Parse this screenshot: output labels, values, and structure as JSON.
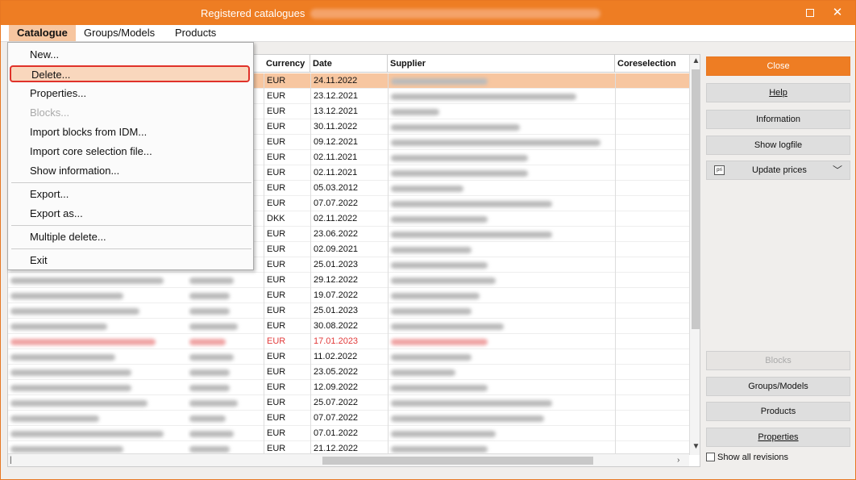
{
  "window": {
    "title": "Registered catalogues"
  },
  "menubar": {
    "catalogue": "Catalogue",
    "groups_models": "Groups/Models",
    "products": "Products"
  },
  "dropdown": {
    "items": [
      {
        "label": "New...",
        "enabled": true
      },
      {
        "label": "Delete...",
        "enabled": true,
        "highlighted": true
      },
      {
        "label": "Properties...",
        "enabled": true
      },
      {
        "label": "Blocks...",
        "enabled": false
      },
      {
        "label": "Import blocks from IDM...",
        "enabled": true
      },
      {
        "label": "Import core selection file...",
        "enabled": true
      },
      {
        "label": "Show information...",
        "enabled": true
      },
      {
        "label": "Export...",
        "enabled": true
      },
      {
        "label": "Export as...",
        "enabled": true
      },
      {
        "label": "Multiple delete...",
        "enabled": true
      },
      {
        "label": "Exit",
        "enabled": true
      }
    ]
  },
  "table": {
    "headers": {
      "currency": "Currency",
      "date": "Date",
      "supplier": "Supplier",
      "coreselection": "Coreselection"
    },
    "rows": [
      {
        "currency": "EUR",
        "date": "24.11.2022",
        "selected": true
      },
      {
        "currency": "EUR",
        "date": "23.12.2021"
      },
      {
        "currency": "EUR",
        "date": "13.12.2021"
      },
      {
        "currency": "EUR",
        "date": "30.11.2022"
      },
      {
        "currency": "EUR",
        "date": "09.12.2021"
      },
      {
        "currency": "EUR",
        "date": "02.11.2021"
      },
      {
        "currency": "EUR",
        "date": "02.11.2021"
      },
      {
        "currency": "EUR",
        "date": "05.03.2012"
      },
      {
        "currency": "EUR",
        "date": "07.07.2022"
      },
      {
        "currency": "DKK",
        "date": "02.11.2022"
      },
      {
        "currency": "EUR",
        "date": "23.06.2022"
      },
      {
        "currency": "EUR",
        "date": "02.09.2021"
      },
      {
        "currency": "EUR",
        "date": "25.01.2023"
      },
      {
        "currency": "EUR",
        "date": "29.12.2022"
      },
      {
        "currency": "EUR",
        "date": "19.07.2022"
      },
      {
        "currency": "EUR",
        "date": "25.01.2023"
      },
      {
        "currency": "EUR",
        "date": "30.08.2022"
      },
      {
        "currency": "EUR",
        "date": "17.01.2023",
        "red": true
      },
      {
        "currency": "EUR",
        "date": "11.02.2022"
      },
      {
        "currency": "EUR",
        "date": "23.05.2022"
      },
      {
        "currency": "EUR",
        "date": "12.09.2022"
      },
      {
        "currency": "EUR",
        "date": "25.07.2022"
      },
      {
        "currency": "EUR",
        "date": "07.07.2022"
      },
      {
        "currency": "EUR",
        "date": "07.01.2022"
      },
      {
        "currency": "EUR",
        "date": "21.12.2022"
      }
    ]
  },
  "panel": {
    "close": "Close",
    "help": "Help",
    "information": "Information",
    "show_logfile": "Show logfile",
    "update_prices": "Update prices",
    "blocks": "Blocks",
    "groups_models": "Groups/Models",
    "products": "Products",
    "properties": "Properties",
    "show_all_revisions": "Show all revisions"
  },
  "colors": {
    "accent": "#ee7d23",
    "selection": "#f7c6a0",
    "highlight_border": "#e0322a",
    "error_row": "#e23b3b"
  }
}
